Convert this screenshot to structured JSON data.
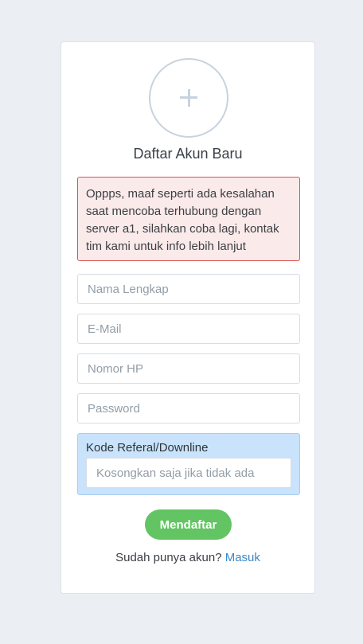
{
  "form": {
    "title": "Daftar Akun Baru",
    "avatar_icon": "plus-icon",
    "error_message": "Oppps, maaf seperti ada kesalahan saat mencoba terhubung dengan server a1, silahkan coba lagi, kontak tim kami untuk info lebih lanjut",
    "fields": {
      "full_name_placeholder": "Nama Lengkap",
      "email_placeholder": "E-Mail",
      "phone_placeholder": "Nomor HP",
      "password_placeholder": "Password"
    },
    "referral": {
      "label": "Kode Referal/Downline",
      "placeholder": "Kosongkan saja jika tidak ada"
    },
    "submit_label": "Mendaftar",
    "login_prompt": "Sudah punya akun?",
    "login_link": "Masuk"
  },
  "colors": {
    "background": "#ebeef2",
    "alert_border": "#d9534f",
    "alert_background": "#fbeaea",
    "referral_background": "#c8e3fb",
    "submit_button": "#62c462",
    "link": "#3a87c8"
  }
}
